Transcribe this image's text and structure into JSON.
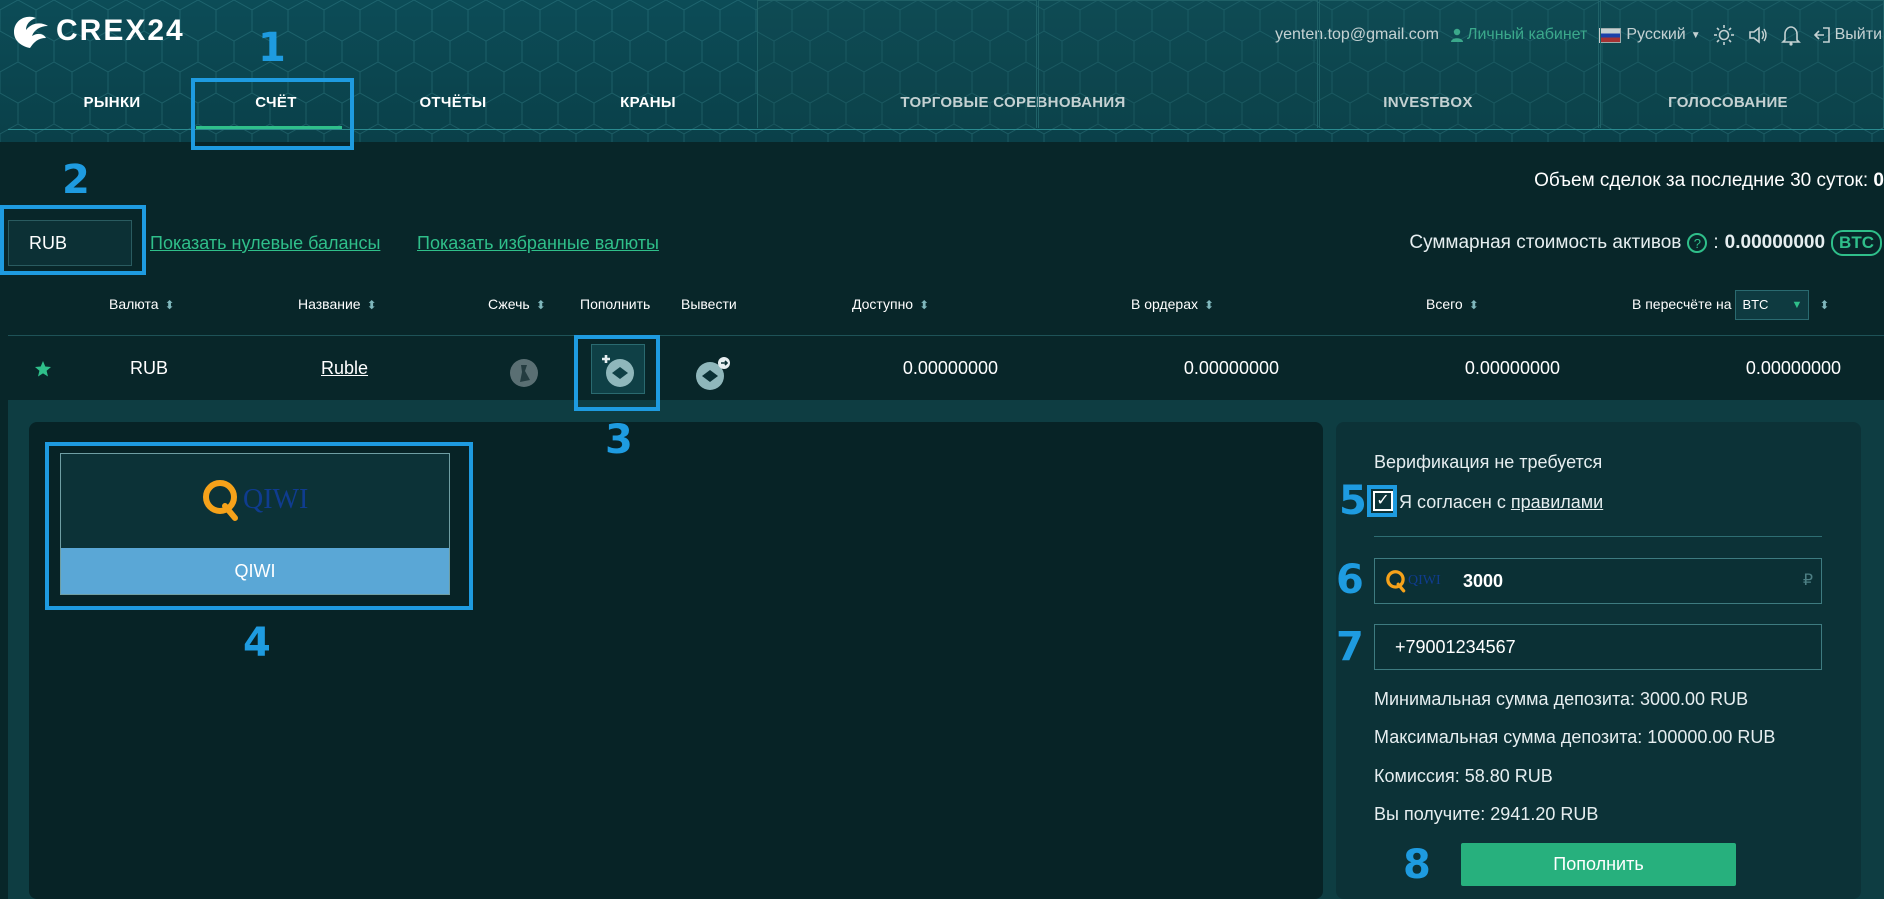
{
  "header": {
    "logo_text": "CREX24",
    "email": "yenten.top@gmail.com",
    "cabinet": "Личный кабинет",
    "language": "Русский",
    "logout": "Выйти"
  },
  "nav": {
    "items": [
      "РЫНКИ",
      "СЧЁТ",
      "ОТЧЁТЫ",
      "КРАНЫ",
      "ТОРГОВЫЕ СОРЕВНОВАНИЯ",
      "INVESTBOX",
      "ГОЛОСОВАНИЕ"
    ],
    "active": "СЧЁТ"
  },
  "toolbar": {
    "volume_label": "Объем сделок за последние 30 суток:",
    "volume_value": "0",
    "currency_filter": "RUB",
    "show_zero": "Показать нулевые балансы",
    "show_favorites": "Показать избранные валюты",
    "assets_label": "Суммарная стоимость активов",
    "help": "?",
    "assets_sep": ":",
    "assets_value": "0.00000000",
    "assets_unit": "BTC"
  },
  "table": {
    "headers": {
      "currency": "Валюта",
      "name": "Название",
      "burn": "Сжечь",
      "deposit": "Пополнить",
      "withdraw": "Вывести",
      "available": "Доступно",
      "in_orders": "В ордерах",
      "total": "Всего",
      "converted": "В пересчёте на",
      "converted_unit": "BTC"
    },
    "row": {
      "currency": "RUB",
      "name": "Ruble",
      "available": "0.00000000",
      "in_orders": "0.00000000",
      "total": "0.00000000",
      "converted": "0.00000000"
    }
  },
  "methods": {
    "qiwi_logo": "QIWI",
    "qiwi_label": "QIWI"
  },
  "form": {
    "verification": "Верификация не требуется",
    "checkbox_mark": "✓",
    "agree_prefix": "Я согласен с",
    "agree_link": "правилами",
    "amount_logo": "QIWI",
    "amount": "3000",
    "currency_symbol": "₽",
    "phone": "+79001234567",
    "min_deposit": "Минимальная сумма депозита: 3000.00 RUB",
    "max_deposit": "Максимальная сумма депозита: 100000.00 RUB",
    "commission": "Комиссия: 58.80 RUB",
    "receive": "Вы получите: 2941.20 RUB",
    "submit": "Пополнить"
  },
  "annotations": [
    "1",
    "2",
    "3",
    "4",
    "5",
    "6",
    "7",
    "8"
  ],
  "colors": {
    "background": "#082629",
    "header": "#0c4c57",
    "accent_green": "#2fbf8a",
    "annotation_blue": "#1e9be0",
    "qiwi_blue": "#5aa7d6",
    "button_green": "#27b07d"
  }
}
